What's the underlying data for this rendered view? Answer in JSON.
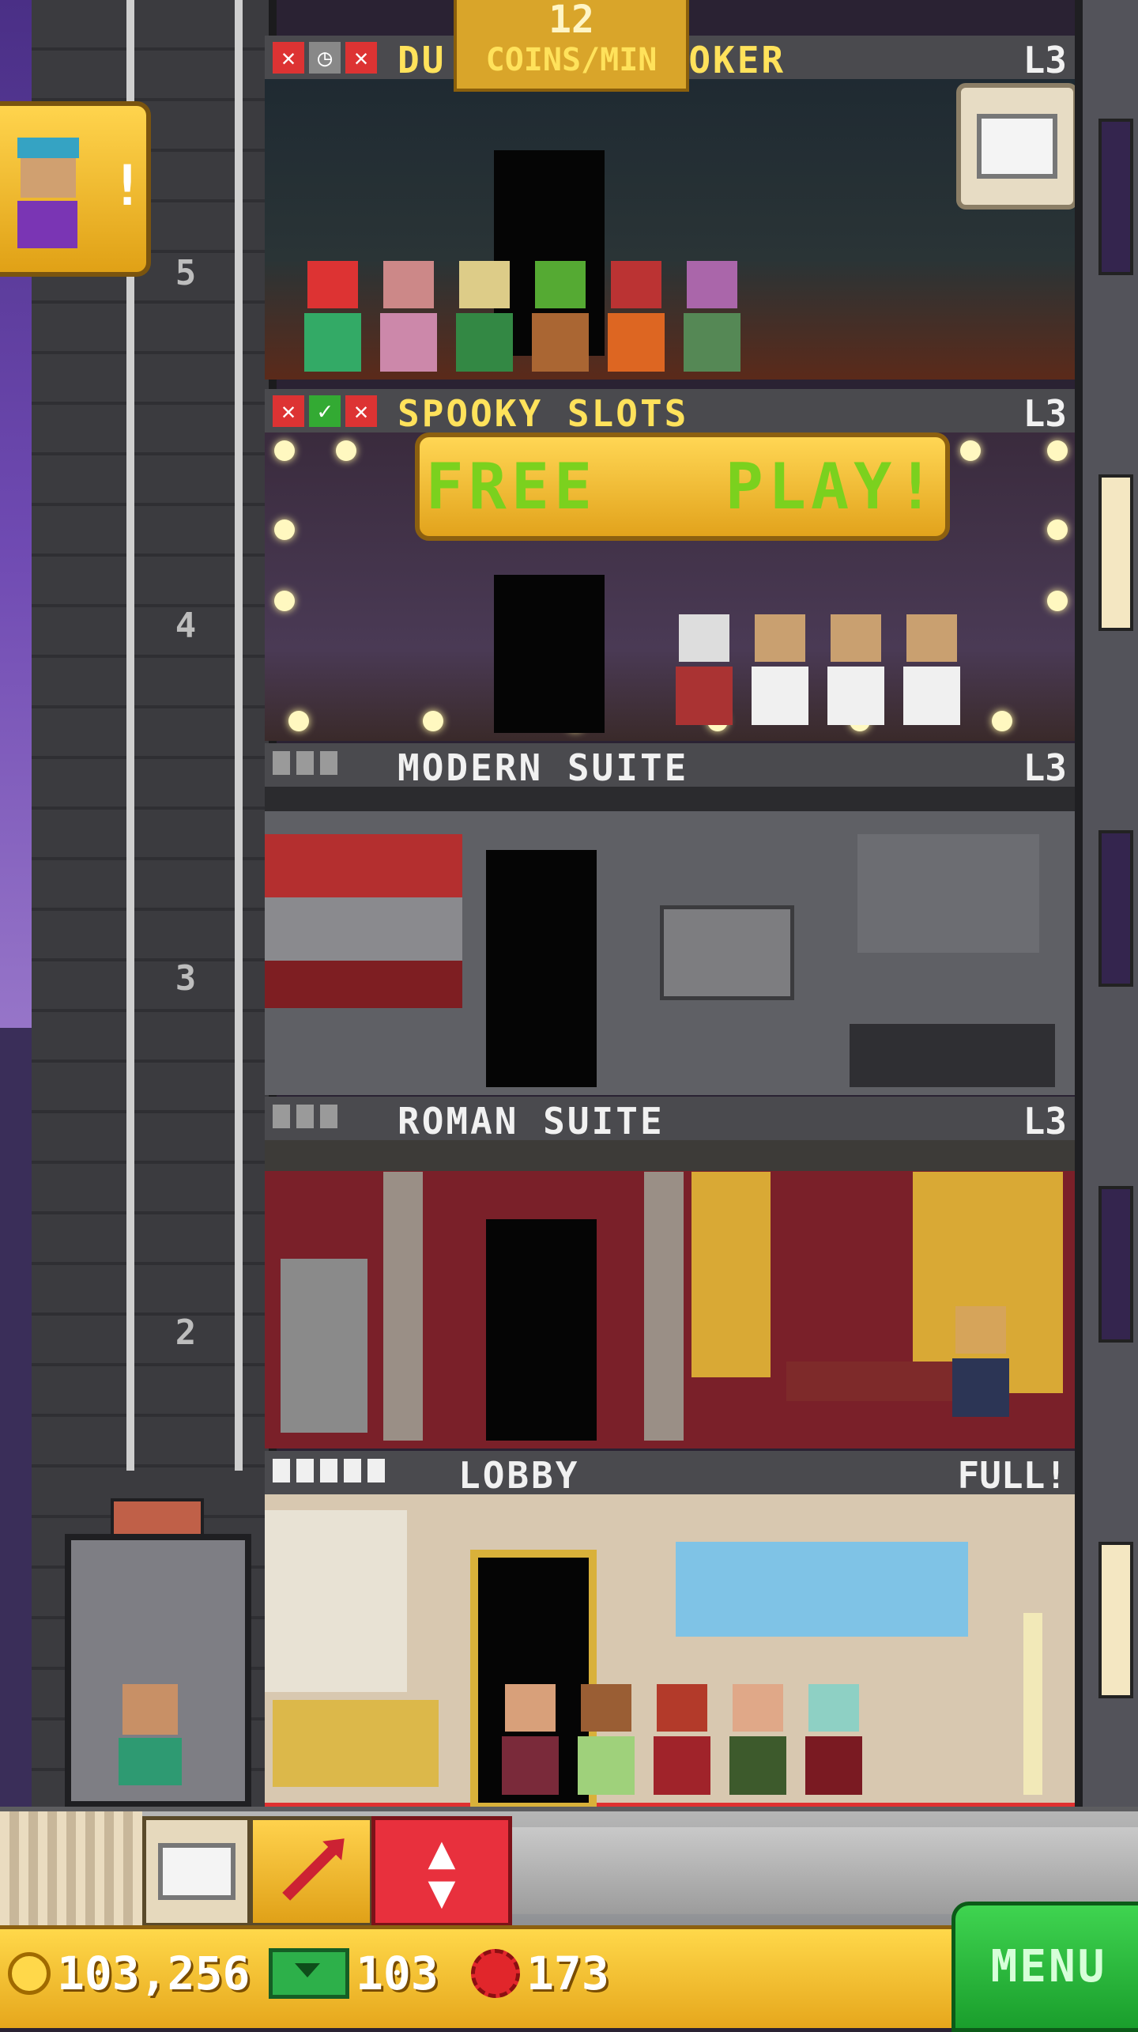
{
  "top_badge": {
    "value": "12",
    "label": "COINS/MIN"
  },
  "floors": [
    {
      "title": "DUNGEON SMOKER",
      "level": "L3",
      "title_visible": "DU          OKER"
    },
    {
      "title": "SPOOKY SLOTS",
      "level": "L3",
      "banner": "FREE   PLAY!"
    },
    {
      "title": "MODERN SUITE",
      "level": "L3"
    },
    {
      "title": "ROMAN SUITE",
      "level": "L3"
    },
    {
      "title": "LOBBY",
      "level": "FULL!"
    }
  ],
  "shaft_numbers": [
    "5",
    "4",
    "3",
    "2"
  ],
  "notification": {
    "mark": "!"
  },
  "currency": {
    "coins": "103,256",
    "bux": "103",
    "gems": "173"
  },
  "menu": {
    "label": "MENU"
  },
  "icons": {
    "status": [
      "close-icon",
      "clock-icon",
      "check-icon"
    ],
    "toolbar": [
      "crate-icon",
      "rocket-icon",
      "up-down-icon"
    ],
    "currency": [
      "coin-icon",
      "bux-icon",
      "gem-icon"
    ]
  },
  "colors": {
    "accent_yellow": "#ffe25b",
    "menu_green": "#2dbf3f",
    "elevator_red": "#e8303d"
  }
}
